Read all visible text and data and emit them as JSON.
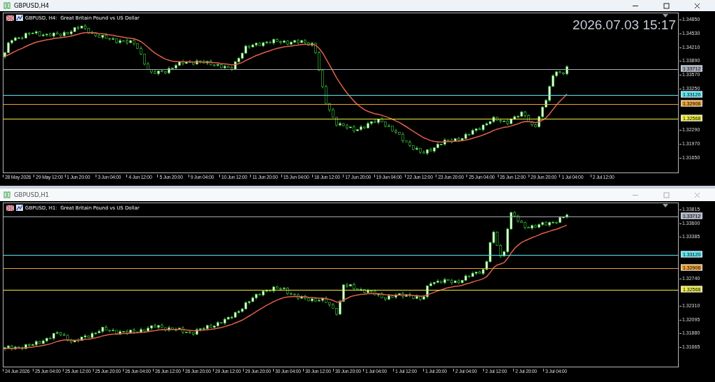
{
  "windows": [
    {
      "title": "GBPUSD,H4",
      "active": true,
      "caption": "GBPUSD, H4:  Great Britain Pound vs US Dollar",
      "clock": "2026.07.03 15:17",
      "price_ticks": [
        "1.34850",
        "1.34530",
        "1.34210",
        "1.33890",
        "1.33570",
        "1.33250",
        "1.32290",
        "1.31970",
        "1.31650"
      ],
      "levels": [
        {
          "price": "1.33712",
          "color": "#a4acb8"
        },
        {
          "price": "1.33120",
          "color": "#5ce6f0"
        },
        {
          "price": "1.32906",
          "color": "#f0a030"
        },
        {
          "price": "1.32568",
          "color": "#f0f040"
        }
      ],
      "time_labels": [
        "28 May 2026",
        "29 May 12:00",
        "1 Jun 20:00",
        "3 Jun 04:00",
        "4 Jun 12:00",
        "5 Jun 20:00",
        "9 Jun 04:00",
        "10 Jun 12:00",
        "11 Jun 20:00",
        "15 Jun 04:00",
        "16 Jun 12:00",
        "17 Jun 20:00",
        "19 Jun 04:00",
        "22 Jun 12:00",
        "23 Jun 20:00",
        "25 Jun 04:00",
        "26 Jun 12:00",
        "29 Jun 20:00",
        "1 Jul 04:00",
        "2 Jul 12:00"
      ]
    },
    {
      "title": "GBPUSD,H1",
      "active": false,
      "caption": "GBPUSD, H1:  Great Britain Pound vs US Dollar",
      "price_ticks": [
        "1.33815",
        "1.33600",
        "1.33385",
        "1.32740",
        "1.32310",
        "1.32095",
        "1.31880",
        "1.31665"
      ],
      "levels": [
        {
          "price": "1.33712",
          "color": "#a4acb8"
        },
        {
          "price": "1.33120",
          "color": "#5ce6f0"
        },
        {
          "price": "1.32906",
          "color": "#f0a030"
        },
        {
          "price": "1.32568",
          "color": "#f0f040"
        }
      ],
      "time_labels": [
        "24 Jun 2026",
        "25 Jun 04:00",
        "25 Jun 12:00",
        "25 Jun 20:00",
        "26 Jun 04:00",
        "26 Jun 12:00",
        "26 Jun 20:00",
        "29 Jun 12:00",
        "29 Jun 20:00",
        "30 Jun 04:00",
        "30 Jun 12:00",
        "30 Jun 20:00",
        "1 Jul 04:00",
        "1 Jul 12:00",
        "1 Jul 20:00",
        "2 Jul 04:00",
        "2 Jul 12:00",
        "2 Jul 20:00",
        "3 Jul 04:00"
      ]
    }
  ]
}
